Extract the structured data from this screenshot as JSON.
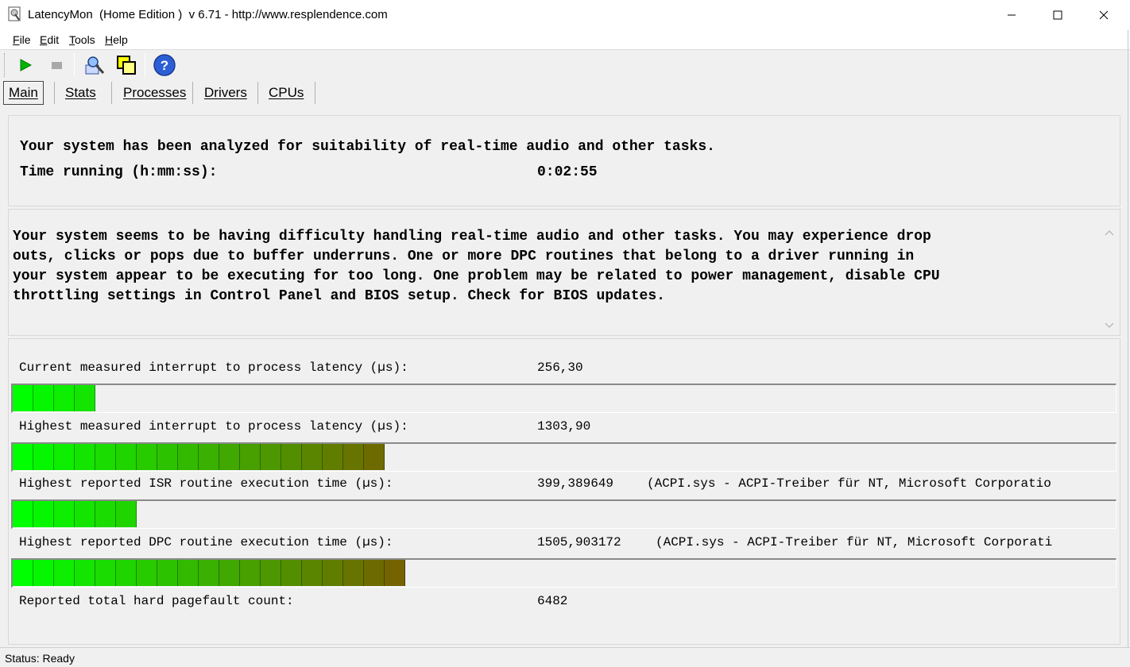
{
  "window": {
    "title": "LatencyMon  (Home Edition )  v 6.71 - http://www.resplendence.com"
  },
  "menu": [
    {
      "u": "F",
      "rest": "ile"
    },
    {
      "u": "E",
      "rest": "dit"
    },
    {
      "u": "T",
      "rest": "ools"
    },
    {
      "u": "H",
      "rest": "elp"
    }
  ],
  "toolbar": {
    "buttons": [
      "start-icon",
      "stop-icon",
      "analyze-icon",
      "windows-icon",
      "help-icon"
    ],
    "help_glyph": "?"
  },
  "tabs": [
    "Main",
    "Stats",
    "Processes",
    "Drivers",
    "CPUs"
  ],
  "summary": {
    "headline": "Your system has been analyzed for suitability of real-time audio and other tasks.",
    "time_label": "Time running (h:mm:ss):",
    "time_value": "0:02:55"
  },
  "verdict": {
    "text": "Your system seems to be having difficulty handling real-time audio and other tasks. You may experience drop\nouts, clicks or pops due to buffer underruns. One or more DPC routines that belong to a driver running in\nyour system appear to be executing for too long. One problem may be related to power management, disable CPU\nthrottling settings in Control Panel and BIOS setup. Check for BIOS updates."
  },
  "metrics": [
    {
      "label": "Current measured interrupt to process latency (µs):",
      "value": "256,30",
      "extra": "",
      "segments": 4
    },
    {
      "label": "Highest measured interrupt to process latency (µs):",
      "value": "1303,90",
      "extra": "",
      "segments": 18
    },
    {
      "label": "Highest reported ISR routine execution time (µs):",
      "value": "399,389649",
      "extra": "(ACPI.sys - ACPI-Treiber für NT, Microsoft Corporatio",
      "segments": 6
    },
    {
      "label": "Highest reported DPC routine execution time (µs):",
      "value": "1505,903172",
      "extra": "(ACPI.sys - ACPI-Treiber für NT, Microsoft Corporati",
      "segments": 19
    },
    {
      "label": "Reported total hard pagefault count:",
      "value": "6482",
      "extra": ""
    }
  ],
  "colors": {
    "bar_start": "#00ff00",
    "bar_end": "#7a5a00"
  },
  "status": "Status: Ready"
}
